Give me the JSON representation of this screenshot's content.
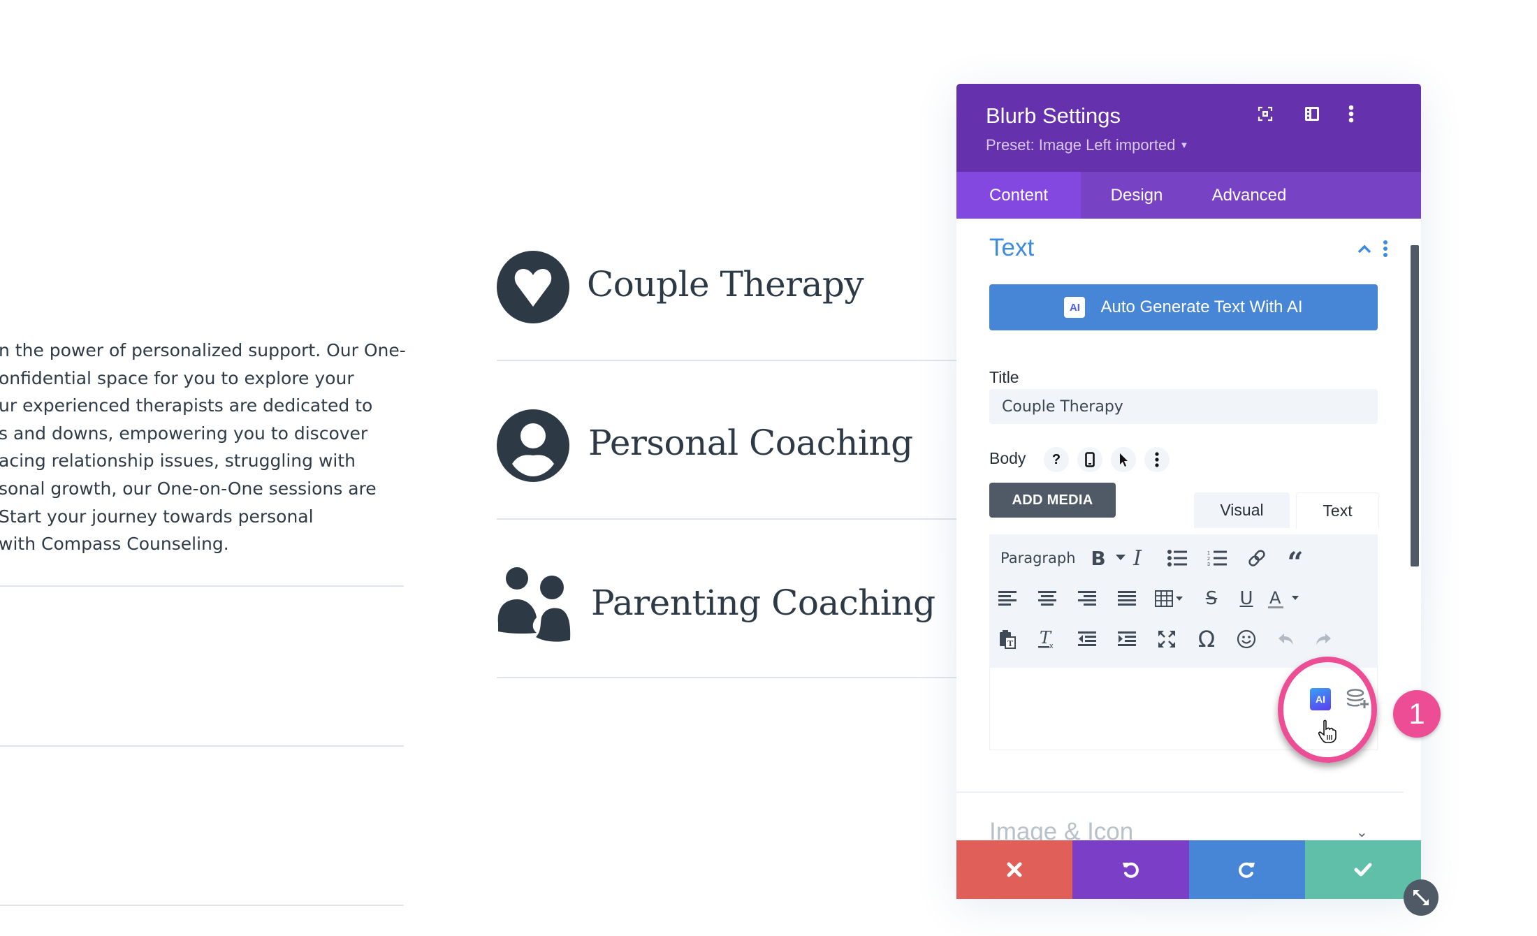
{
  "page": {
    "paragraph_lines": [
      "n the power of personalized support. Our One-",
      "onfidential space for you to explore your",
      "ur experienced therapists are dedicated to",
      "s and downs, empowering you to discover",
      "acing relationship issues, struggling with",
      "sonal growth, our One-on-One sessions are",
      "Start your journey towards personal",
      "with Compass Counseling."
    ],
    "blurbs": [
      {
        "title": "Couple Therapy",
        "icon": "heart-circle-icon"
      },
      {
        "title": "Personal Coaching",
        "icon": "user-circle-icon"
      },
      {
        "title": "Parenting Coaching",
        "icon": "parent-child-icon"
      }
    ],
    "icon_color": "#2d3a45"
  },
  "panel": {
    "title": "Blurb Settings",
    "preset": "Preset: Image Left imported",
    "header_icons": [
      "focus-icon",
      "split-view-icon",
      "more-vertical-icon"
    ],
    "tabs": [
      {
        "label": "Content",
        "active": true
      },
      {
        "label": "Design",
        "active": false
      },
      {
        "label": "Advanced",
        "active": false
      }
    ],
    "section": {
      "title": "Text",
      "ai_button": "Auto Generate Text With AI",
      "ai_badge": "AI",
      "title_label": "Title",
      "title_value": "Couple Therapy",
      "body_label": "Body",
      "body_icons": [
        "help-icon",
        "mobile-icon",
        "pointer-icon",
        "more-vertical-icon"
      ],
      "add_media": "ADD MEDIA",
      "editor_tabs": [
        "Visual",
        "Text"
      ],
      "paragraph_select": "Paragraph",
      "toolbar_row1": [
        "bold-icon",
        "italic-icon",
        "bulleted-list-icon",
        "numbered-list-icon",
        "link-icon",
        "blockquote-icon"
      ],
      "toolbar_row2": [
        "align-left-icon",
        "align-center-icon",
        "align-right-icon",
        "align-justify-icon",
        "table-icon",
        "strikethrough-icon",
        "underline-icon",
        "text-color-icon"
      ],
      "toolbar_row3": [
        "paste-text-icon",
        "clear-formatting-icon",
        "outdent-icon",
        "indent-icon",
        "fullscreen-icon",
        "special-character-icon",
        "emoji-icon",
        "undo-icon",
        "redo-icon"
      ],
      "editor_ai_badge": "AI"
    },
    "next_section": "Image & Icon",
    "footer": [
      "close-icon",
      "undo-icon",
      "redo-icon",
      "save-check-icon"
    ],
    "colors": {
      "header": "#6531ad",
      "tabs": "#7842c5",
      "active_tab": "#8248e0",
      "accent_blue": "#4785d7",
      "cancel": "#e05f59",
      "undo": "#7b3fc7",
      "redo": "#4785d7",
      "save": "#5fbfa8"
    }
  },
  "annotation": {
    "step_number": "1",
    "color": "#ec4d95"
  }
}
